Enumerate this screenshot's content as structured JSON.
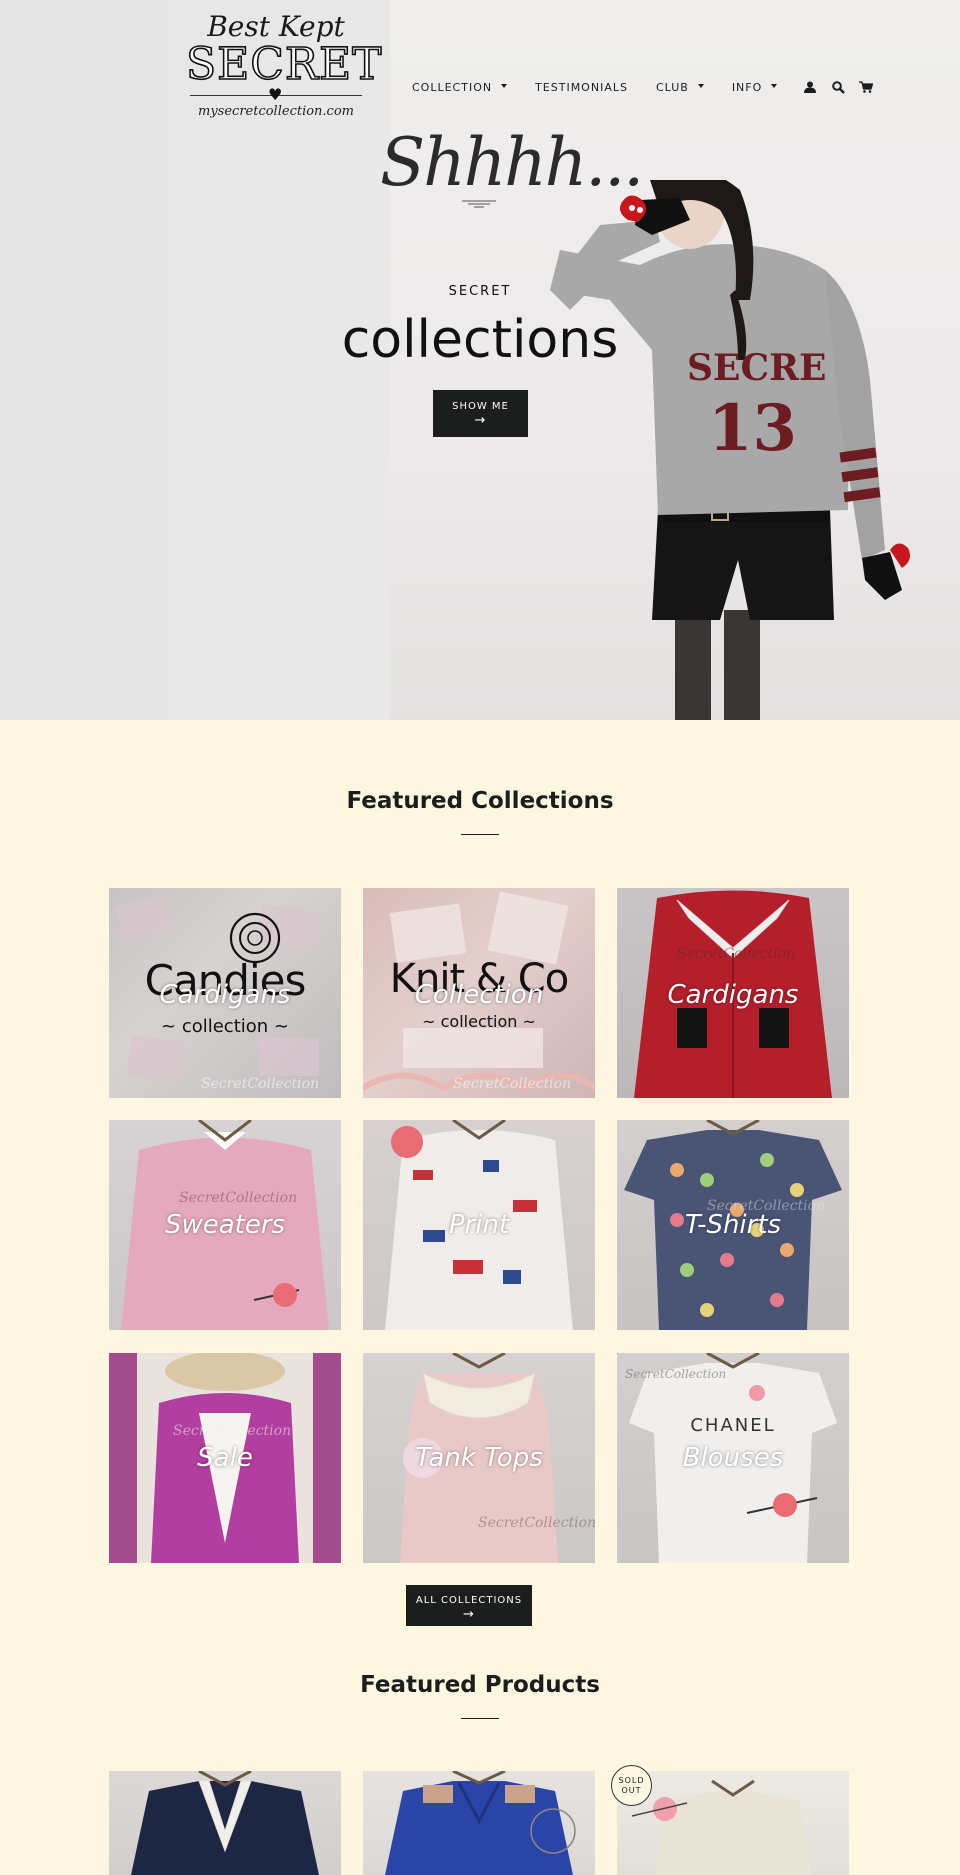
{
  "logo": {
    "line1": "Best Kept",
    "line2": "SECRET",
    "line3": "mysecretcollection.com"
  },
  "nav": {
    "items": [
      {
        "label": "COLLECTION",
        "dropdown": true
      },
      {
        "label": "TESTIMONIALS",
        "dropdown": false
      },
      {
        "label": "CLUB",
        "dropdown": true
      },
      {
        "label": "INFO",
        "dropdown": true
      }
    ],
    "icons": [
      "account-icon",
      "search-icon",
      "cart-icon"
    ]
  },
  "hero": {
    "script_text": "Shhhh...",
    "sweater_text": "SECRE",
    "sweater_number": "13",
    "kicker": "SECRET",
    "title": "collections",
    "button_label": "SHOW ME",
    "button_arrow": "→"
  },
  "featured_collections": {
    "title": "Featured Collections",
    "items": [
      {
        "label": "Cardigans",
        "art_text": "Candies",
        "art_sub": "~ collection ~",
        "watermark": "SecretCollection"
      },
      {
        "label": "Collection",
        "art_text": "Knit & Co",
        "art_sub": "~ collection ~",
        "watermark": "SecretCollection"
      },
      {
        "label": "Cardigans",
        "watermark": "SecretCollection"
      },
      {
        "label": "Sweaters",
        "watermark": "SecretCollection"
      },
      {
        "label": "Print"
      },
      {
        "label": "T-Shirts",
        "watermark": "SecretCollection"
      },
      {
        "label": "Sale",
        "watermark": "SecretCollection"
      },
      {
        "label": "Tank Tops",
        "watermark": "SecretCollection"
      },
      {
        "label": "Blouses",
        "art_text": "CHANEL",
        "watermark": "SecretCollection"
      }
    ],
    "button_label": "ALL COLLECTIONS",
    "button_arrow": "→"
  },
  "featured_products": {
    "title": "Featured Products",
    "badge": [
      "SOLD",
      "OUT"
    ]
  },
  "colors": {
    "page_bg": "#fdf6e1",
    "hero_bg": "#e8e7e6",
    "button_bg": "#1c1d1d",
    "sweater_grey": "#a9a8a8",
    "sweater_red": "#6d1d22"
  }
}
